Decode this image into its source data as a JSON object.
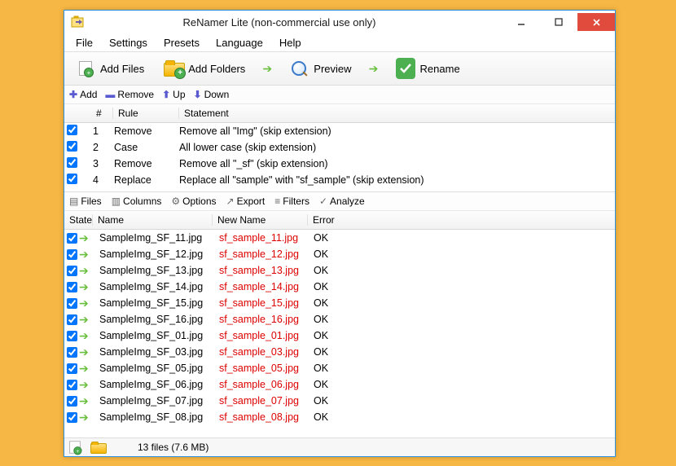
{
  "title": "ReNamer Lite (non-commercial use only)",
  "menu": {
    "file": "File",
    "settings": "Settings",
    "presets": "Presets",
    "language": "Language",
    "help": "Help"
  },
  "toolbar": {
    "add_files": "Add Files",
    "add_folders": "Add Folders",
    "preview": "Preview",
    "rename": "Rename"
  },
  "rulesbar": {
    "add": "Add",
    "remove": "Remove",
    "up": "Up",
    "down": "Down"
  },
  "rules_header": {
    "num": "#",
    "rule": "Rule",
    "stmt": "Statement"
  },
  "rules": [
    {
      "num": "1",
      "rule": "Remove",
      "stmt": "Remove all \"Img\" (skip extension)"
    },
    {
      "num": "2",
      "rule": "Case",
      "stmt": "All lower case (skip extension)"
    },
    {
      "num": "3",
      "rule": "Remove",
      "stmt": "Remove all \"_sf\" (skip extension)"
    },
    {
      "num": "4",
      "rule": "Replace",
      "stmt": "Replace all \"sample\" with \"sf_sample\" (skip extension)"
    }
  ],
  "filebar": {
    "files": "Files",
    "columns": "Columns",
    "options": "Options",
    "export": "Export",
    "filters": "Filters",
    "analyze": "Analyze"
  },
  "files_header": {
    "state": "State",
    "name": "Name",
    "newname": "New Name",
    "error": "Error"
  },
  "files": [
    {
      "name": "SampleImg_SF_11.jpg",
      "newname": "sf_sample_11.jpg",
      "error": "OK"
    },
    {
      "name": "SampleImg_SF_12.jpg",
      "newname": "sf_sample_12.jpg",
      "error": "OK"
    },
    {
      "name": "SampleImg_SF_13.jpg",
      "newname": "sf_sample_13.jpg",
      "error": "OK"
    },
    {
      "name": "SampleImg_SF_14.jpg",
      "newname": "sf_sample_14.jpg",
      "error": "OK"
    },
    {
      "name": "SampleImg_SF_15.jpg",
      "newname": "sf_sample_15.jpg",
      "error": "OK"
    },
    {
      "name": "SampleImg_SF_16.jpg",
      "newname": "sf_sample_16.jpg",
      "error": "OK"
    },
    {
      "name": "SampleImg_SF_01.jpg",
      "newname": "sf_sample_01.jpg",
      "error": "OK"
    },
    {
      "name": "SampleImg_SF_03.jpg",
      "newname": "sf_sample_03.jpg",
      "error": "OK"
    },
    {
      "name": "SampleImg_SF_05.jpg",
      "newname": "sf_sample_05.jpg",
      "error": "OK"
    },
    {
      "name": "SampleImg_SF_06.jpg",
      "newname": "sf_sample_06.jpg",
      "error": "OK"
    },
    {
      "name": "SampleImg_SF_07.jpg",
      "newname": "sf_sample_07.jpg",
      "error": "OK"
    },
    {
      "name": "SampleImg_SF_08.jpg",
      "newname": "sf_sample_08.jpg",
      "error": "OK"
    }
  ],
  "status": "13 files (7.6 MB)"
}
